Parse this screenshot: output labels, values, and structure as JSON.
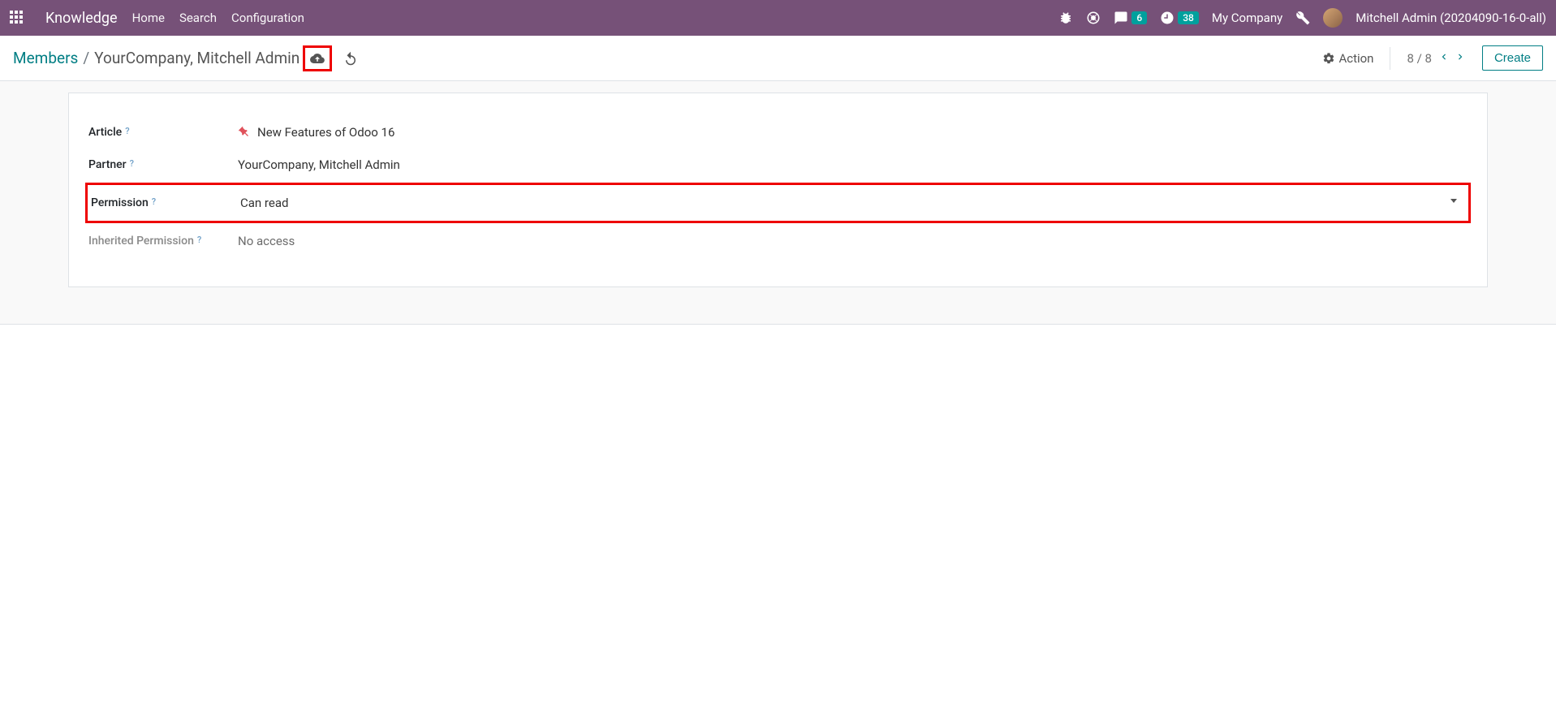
{
  "navbar": {
    "brand": "Knowledge",
    "links": {
      "home": "Home",
      "search": "Search",
      "config": "Configuration"
    },
    "badges": {
      "messages": "6",
      "activities": "38"
    },
    "company": "My Company",
    "user": "Mitchell Admin (20204090-16-0-all)"
  },
  "breadcrumb": {
    "root": "Members",
    "current": "YourCompany, Mitchell Admin"
  },
  "control": {
    "action": "Action",
    "pager": "8 / 8",
    "create": "Create"
  },
  "form": {
    "article_label": "Article",
    "article_value": "New Features of Odoo 16",
    "partner_label": "Partner",
    "partner_value": "YourCompany, Mitchell Admin",
    "permission_label": "Permission",
    "permission_value": "Can read",
    "inherited_label": "Inherited Permission",
    "inherited_value": "No access",
    "help": "?"
  }
}
